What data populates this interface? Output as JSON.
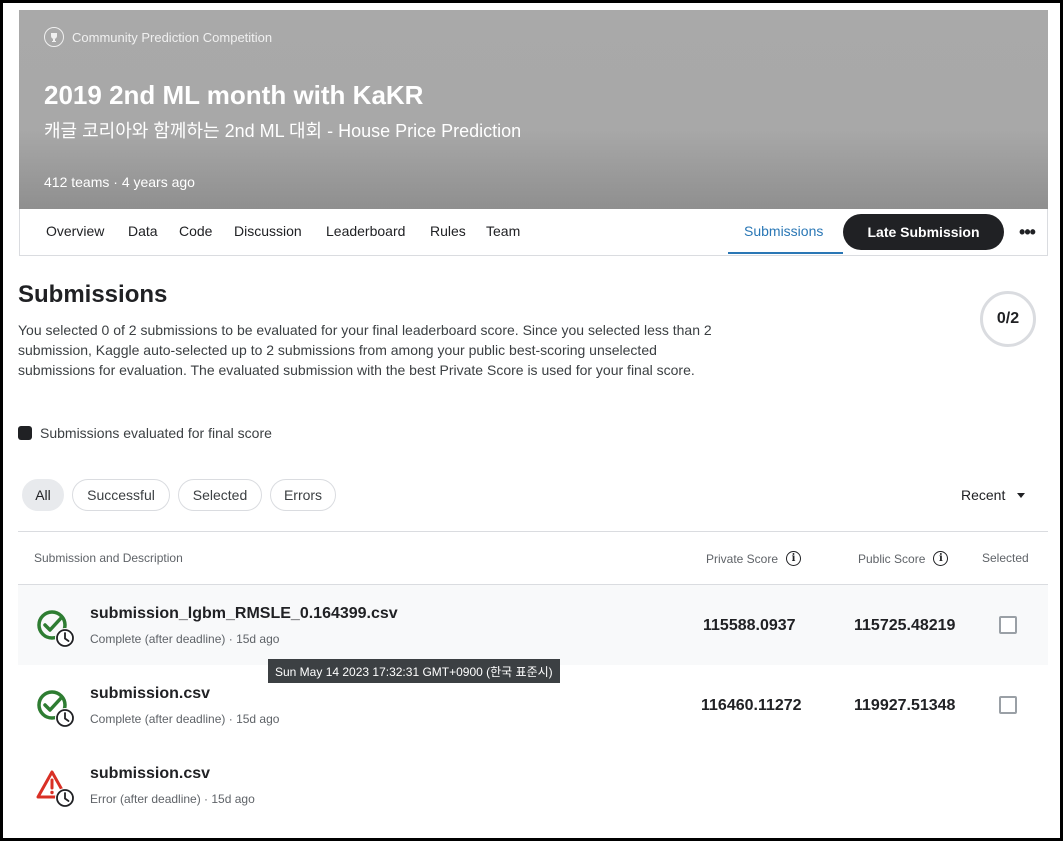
{
  "header": {
    "competition_type": "Community Prediction Competition",
    "title": "2019 2nd ML month with KaKR",
    "subtitle": "캐글 코리아와 함께하는 2nd ML 대회 - House Price Prediction",
    "meta": "412 teams · 4 years ago"
  },
  "tabs": {
    "items": [
      "Overview",
      "Data",
      "Code",
      "Discussion",
      "Leaderboard",
      "Rules",
      "Team"
    ],
    "active": "Submissions",
    "late_submission": "Late Submission",
    "more": "•••"
  },
  "submissions": {
    "title": "Submissions",
    "description": "You selected 0 of 2 submissions to be evaluated for your final leaderboard score. Since you selected less than 2 submission, Kaggle auto-selected up to 2 submissions from among your public best-scoring unselected submissions for evaluation. The evaluated submission with the best Private Score is used for your final score.",
    "counter": "0/2",
    "legend": "Submissions evaluated for final score"
  },
  "filters": {
    "chips": [
      "All",
      "Successful",
      "Selected",
      "Errors"
    ],
    "active": "All",
    "sort": "Recent"
  },
  "table": {
    "headers": {
      "submission": "Submission and Description",
      "private": "Private Score",
      "public": "Public Score",
      "selected": "Selected"
    },
    "rows": [
      {
        "name": "submission_lgbm_RMSLE_0.164399.csv",
        "status": "Complete (after deadline) · 15d ago",
        "private": "115588.0937",
        "public": "115725.48219",
        "state": "success"
      },
      {
        "name": "submission.csv",
        "status": "Complete (after deadline) · 15d ago",
        "private": "116460.11272",
        "public": "119927.51348",
        "state": "success"
      },
      {
        "name": "submission.csv",
        "status": "Error (after deadline) · 15d ago",
        "private": "",
        "public": "",
        "state": "error"
      }
    ]
  },
  "tooltip": "Sun May 14 2023 17:32:31 GMT+0900 (한국 표준시)",
  "colors": {
    "success": "#2e7d32",
    "error": "#d93025",
    "accent": "#2a77b5",
    "dark": "#202124"
  },
  "icons": {
    "competition_type": "trophy-icon",
    "status_success": "check-circle-icon",
    "status_error": "warning-triangle-icon",
    "status_time": "clock-icon",
    "info": "info-icon",
    "sort": "chevron-down-icon"
  }
}
